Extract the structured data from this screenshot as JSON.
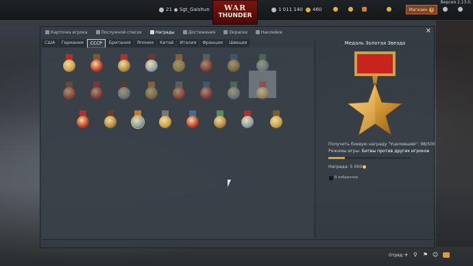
{
  "app": {
    "version": "Версия 2.13.0.",
    "logo_line1": "WAR",
    "logo_line2": "THUNDER"
  },
  "topbar": {
    "player_level": "21",
    "player_name": "Sgt_Gaishun",
    "silver_lions": "1 011 140",
    "research_points": "460",
    "store_label": "Магазин",
    "store_badge": "!"
  },
  "window": {
    "tabs": [
      {
        "label": "Карточка игрока",
        "icon": "player-card-icon"
      },
      {
        "label": "Послужной список",
        "icon": "service-record-icon"
      },
      {
        "label": "Награды",
        "icon": "trophy-icon",
        "active": true
      },
      {
        "label": "Достижения",
        "icon": "achievements-icon"
      },
      {
        "label": "Окраски",
        "icon": "paint-icon"
      },
      {
        "label": "Наклейки",
        "icon": "decal-icon"
      }
    ],
    "nations": [
      {
        "label": "США"
      },
      {
        "label": "Германия"
      },
      {
        "label": "СССР",
        "active": true
      },
      {
        "label": "Британия"
      },
      {
        "label": "Япония"
      },
      {
        "label": "Китай"
      },
      {
        "label": "Италия"
      },
      {
        "label": "Франция"
      },
      {
        "label": "Швеция"
      }
    ]
  },
  "details": {
    "title": "Медаль Золотая Звезда",
    "requirement": "Получить боевую награду \"Уцелевший\": 98/500",
    "mode_label": "Режимы игры:",
    "mode_value": "Битвы против других игроков",
    "progress": 0.196,
    "reward_label": "Награда: 5 000",
    "favorite_label": "В избранное"
  },
  "bottom": {
    "squad_label": "Отряд:"
  }
}
